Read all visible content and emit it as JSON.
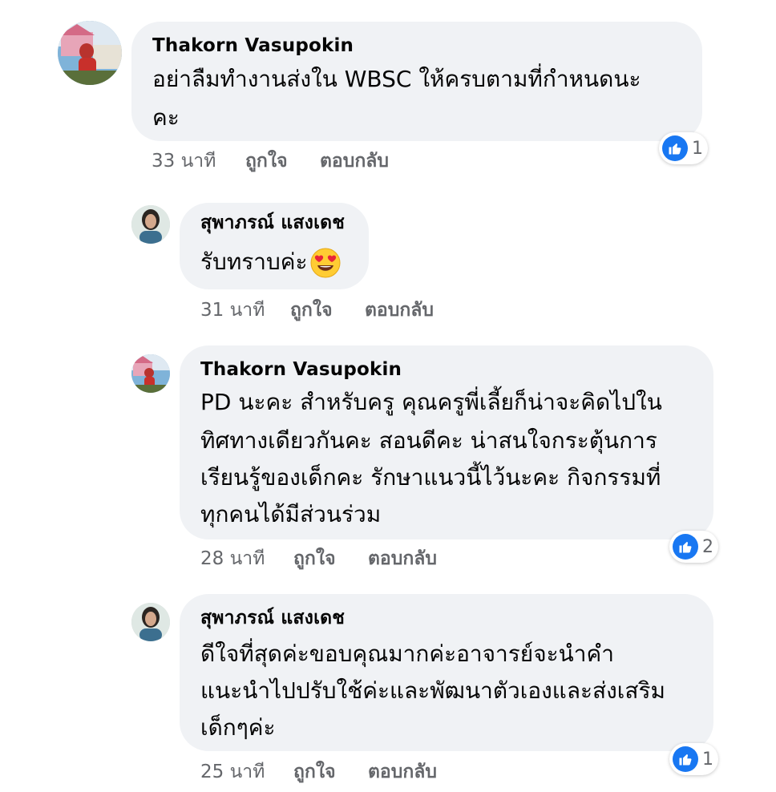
{
  "colors": {
    "bubble_bg": "#f0f2f5",
    "like_blue": "#1877f2",
    "meta_gray": "#65676b",
    "text": "#050505"
  },
  "comments": [
    {
      "author": "Thakorn Vasupokin",
      "lines": [
        "อย่าลืมทำงานส่งใน WBSC ให้ครบตามที่กำหนดนะ",
        "คะ"
      ],
      "time": "33 นาที",
      "like_label": "ถูกใจ",
      "reply_label": "ตอบกลับ",
      "reactions": {
        "icon": "like-icon",
        "count": "1"
      }
    },
    {
      "author": "สุพาภรณ์ แสงเดช",
      "lines": [
        "รับทราบค่ะ"
      ],
      "emoji": "heart-eyes-emoji",
      "time": "31 นาที",
      "like_label": "ถูกใจ",
      "reply_label": "ตอบกลับ"
    },
    {
      "author": "Thakorn Vasupokin",
      "lines": [
        "PD นะคะ สำหรับครู คุณครูพี่เลี้ยก็น่าจะคิดไปใน",
        "ทิศทางเดียวกันคะ  สอนดีคะ น่าสนใจกระตุ้นการ",
        "เรียนรู้ของเด็กคะ รักษาแนวนี้ไว้นะคะ กิจกรรมที่",
        "ทุกคนได้มีส่วนร่วม"
      ],
      "time": "28 นาที",
      "like_label": "ถูกใจ",
      "reply_label": "ตอบกลับ",
      "reactions": {
        "icon": "like-icon",
        "count": "2"
      }
    },
    {
      "author": "สุพาภรณ์ แสงเดช",
      "lines": [
        "ดีใจที่สุดค่ะขอบคุณมากค่ะอาจารย์จะนำคำ",
        "แนะนำไปปรับใช้ค่ะและพัฒนาตัวเองและส่งเสริม",
        "เด็กๆค่ะ"
      ],
      "time": "25 นาที",
      "like_label": "ถูกใจ",
      "reply_label": "ตอบกลับ",
      "reactions": {
        "icon": "like-icon",
        "count": "1"
      }
    }
  ]
}
